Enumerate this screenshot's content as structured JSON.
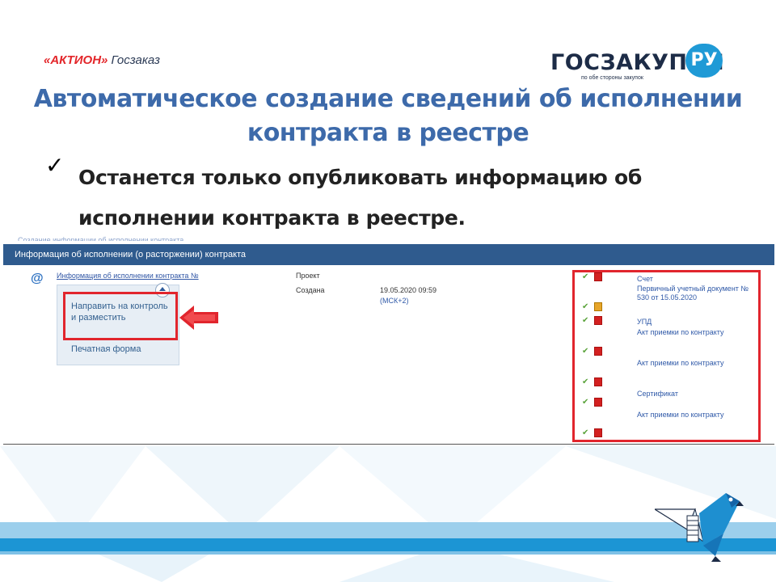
{
  "header": {
    "left_logo_brand": "«АКТИОН»",
    "left_logo_product": "Госзаказ",
    "right_logo_word": "ГОСЗАКУПКИ",
    "right_logo_suffix": "РУ",
    "right_logo_tagline": "по обе стороны закупок"
  },
  "slide": {
    "title_line1": "Автоматическое создание сведений об исполнении",
    "title_line2": "контракта в реестре",
    "check_mark": "✓",
    "bullet_line1": "Останется только опубликовать информацию об",
    "bullet_line2": "исполнении контракта в реестре."
  },
  "screenshot": {
    "breadcrumb": "Создание информации об исполнении контракта",
    "bar_title": "Информация об исполнении (о расторжении) контракта",
    "info_link": "Информация об исполнении контракта №",
    "menu": {
      "send_label": "Направить на контроль и разместить",
      "print_label": "Печатная форма"
    },
    "status_label": "Проект",
    "created_label": "Создана",
    "created_date": "19.05.2020 09:59",
    "timezone": "(МСК+2)",
    "documents": [
      "Счет",
      "Первичный учетный документ № 530 от 15.05.2020",
      "УПД",
      "Акт приемки по контракту",
      "Акт приемки по контракту",
      "Сертификат",
      "Акт приемки по контракту"
    ]
  },
  "colors": {
    "title": "#3d6aaa",
    "bar": "#2f5b8e",
    "highlight": "#e1252d",
    "link": "#2f59a8"
  }
}
